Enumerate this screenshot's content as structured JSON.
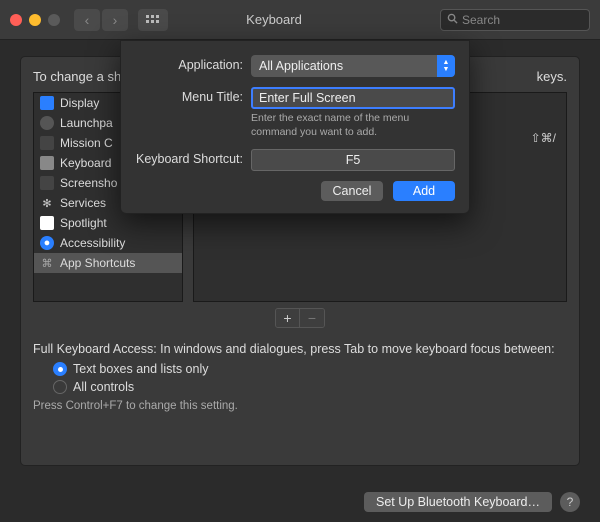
{
  "window": {
    "title": "Keyboard",
    "search_placeholder": "Search"
  },
  "panel": {
    "heading": "To change a shortcut, select it, click the key combination, and then type the new keys.",
    "heading_truncated": "To change a sh",
    "heading_tail": "keys.",
    "sidebar": [
      {
        "icon": "display",
        "label": "Display"
      },
      {
        "icon": "launchpad",
        "label": "Launchpad & Dock",
        "truncated": "Launchpa"
      },
      {
        "icon": "mission",
        "label": "Mission Control",
        "truncated": "Mission C"
      },
      {
        "icon": "keyboard",
        "label": "Keyboard"
      },
      {
        "icon": "screenshot",
        "label": "Screenshots",
        "truncated": "Screensho"
      },
      {
        "icon": "services",
        "label": "Services"
      },
      {
        "icon": "spotlight",
        "label": "Spotlight"
      },
      {
        "icon": "accessibility",
        "label": "Accessibility"
      },
      {
        "icon": "appshortcuts",
        "label": "App Shortcuts"
      }
    ],
    "right_shortcut": "⇧⌘/"
  },
  "controls": {
    "plus": "+",
    "minus": "−"
  },
  "keyboard_access": {
    "text": "Full Keyboard Access: In windows and dialogues, press Tab to move keyboard focus between:",
    "opt1": "Text boxes and lists only",
    "opt2": "All controls",
    "hint": "Press Control+F7 to change this setting."
  },
  "bottom": {
    "bluetooth": "Set Up Bluetooth Keyboard…",
    "help": "?"
  },
  "sheet": {
    "application_label": "Application:",
    "application_value": "All Applications",
    "menu_title_label": "Menu Title:",
    "menu_title_value": "Enter Full Screen",
    "menu_title_help": "Enter the exact name of the menu command you want to add.",
    "shortcut_label": "Keyboard Shortcut:",
    "shortcut_value": "F5",
    "cancel": "Cancel",
    "add": "Add"
  }
}
